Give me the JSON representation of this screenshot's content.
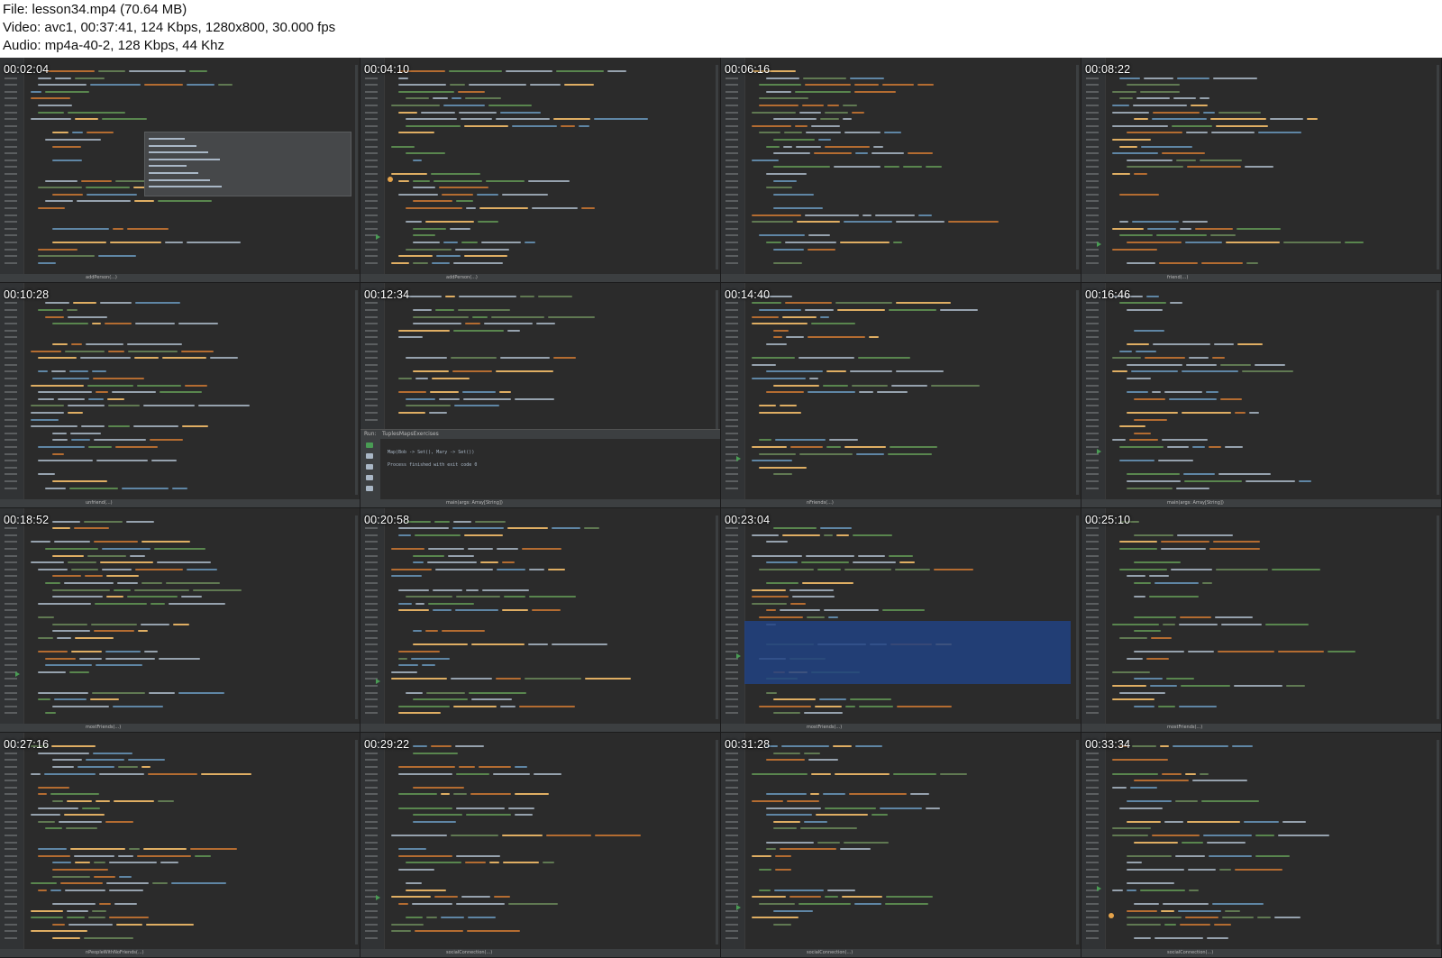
{
  "info": {
    "file": "File: lesson34.mp4 (70.64 MB)",
    "video": "Video: avc1, 00:37:41, 124 Kbps, 1280x800, 30.000 fps",
    "audio": "Audio: mp4a-40-2, 128 Kbps, 44 Khz"
  },
  "colors": {
    "editor_bg": "#2b2b2b",
    "keyword": "#cc7832",
    "function": "#ffc66d",
    "type": "#a9b7c6",
    "string": "#6a8759",
    "comment": "#629755",
    "number": "#6897bb",
    "selection": "#214283"
  },
  "thumbnails": [
    {
      "time": "00:02:04",
      "breadcrumb": "addPerson(...)",
      "has_autocomplete": true
    },
    {
      "time": "00:04:10",
      "breadcrumb": "addPerson(...)"
    },
    {
      "time": "00:06:16",
      "breadcrumb": ""
    },
    {
      "time": "00:08:22",
      "breadcrumb": "friend(...)"
    },
    {
      "time": "00:10:28",
      "breadcrumb": "unfriend(...)"
    },
    {
      "time": "00:12:34",
      "breadcrumb": "main(args: Array[String])",
      "has_run_panel": true
    },
    {
      "time": "00:14:40",
      "breadcrumb": "nFriends(...)"
    },
    {
      "time": "00:16:46",
      "breadcrumb": "main(args: Array[String])"
    },
    {
      "time": "00:18:52",
      "breadcrumb": "mostFriends(...)"
    },
    {
      "time": "00:20:58",
      "breadcrumb": ""
    },
    {
      "time": "00:23:04",
      "breadcrumb": "mostFriends(...)",
      "has_selection": true
    },
    {
      "time": "00:25:10",
      "breadcrumb": "mostFriends(...)"
    },
    {
      "time": "00:27:16",
      "breadcrumb": "nPeopleWithNoFriends(...)"
    },
    {
      "time": "00:29:22",
      "breadcrumb": "socialConnection(...)"
    },
    {
      "time": "00:31:28",
      "breadcrumb": "socialConnection(...)"
    },
    {
      "time": "00:33:34",
      "breadcrumb": "socialConnection(...)"
    }
  ],
  "run_panel": {
    "title": "Run:",
    "config": "TuplesMapsExercises",
    "output_line": "Map(Bob -> Set(), Mary -> Set())",
    "finished": "Process finished with exit code 0"
  }
}
